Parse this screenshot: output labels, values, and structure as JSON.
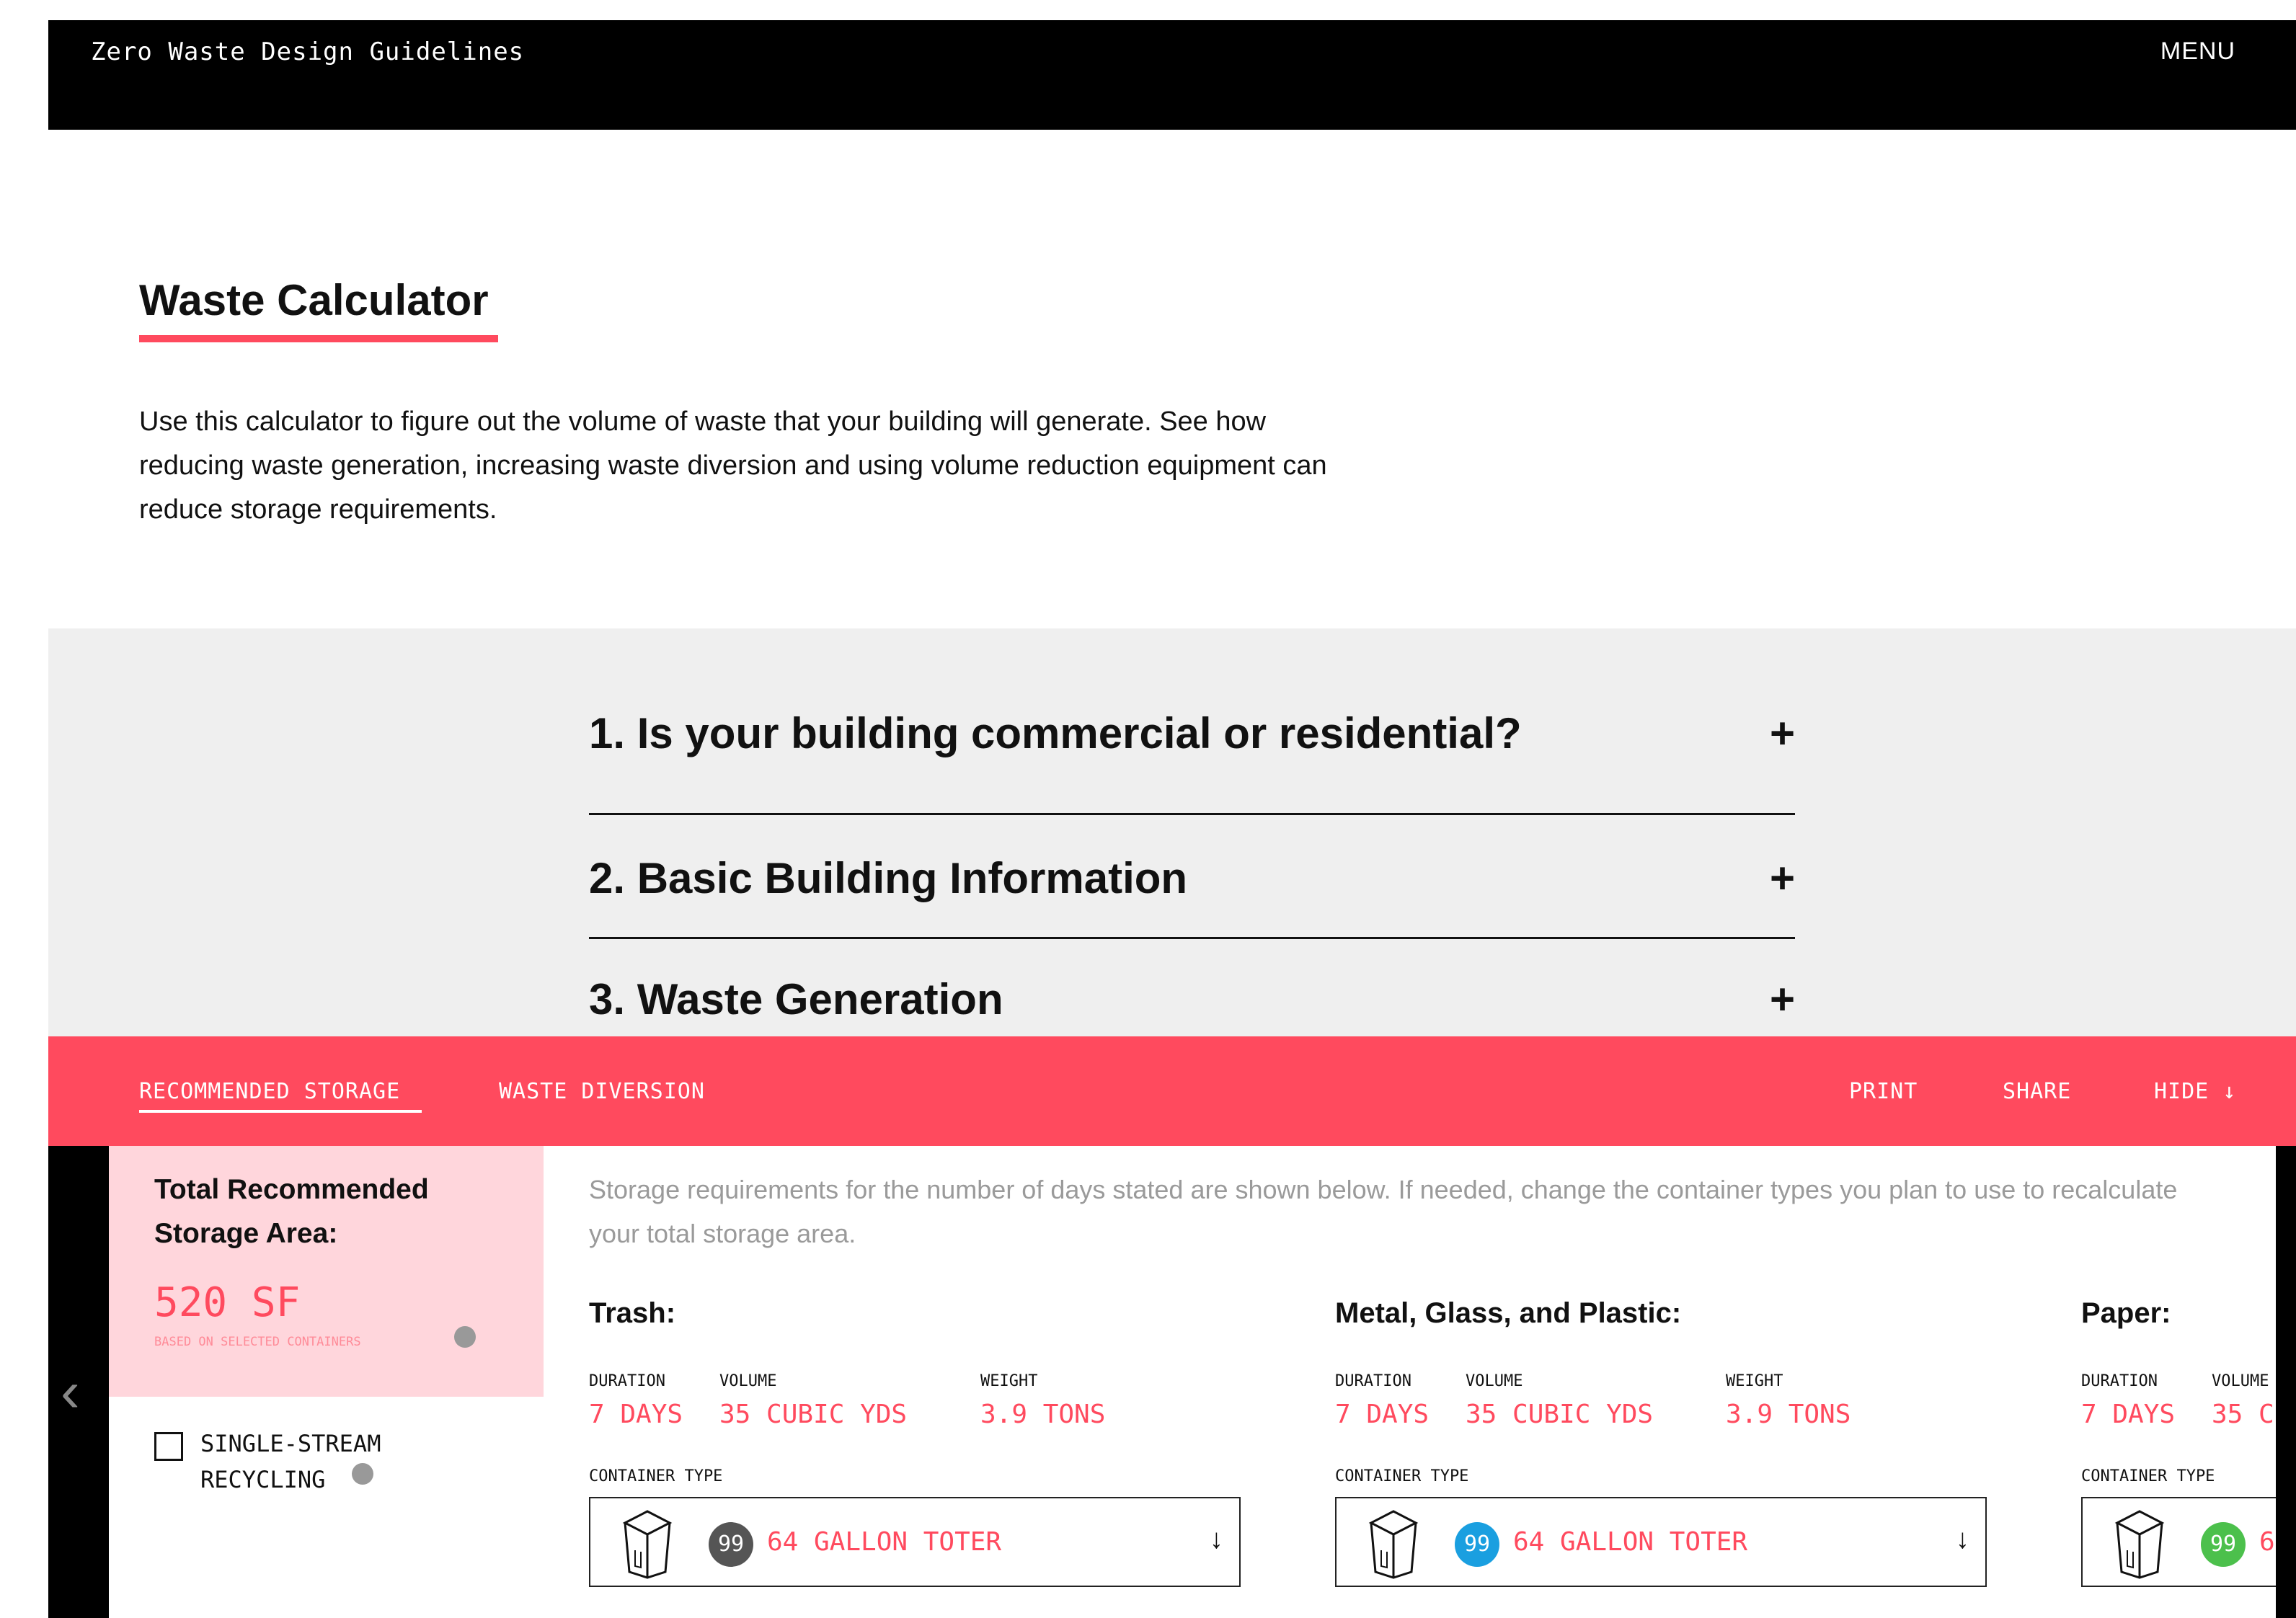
{
  "header": {
    "site_title": "Zero Waste Design Guidelines",
    "menu_label": "MENU"
  },
  "page": {
    "title": "Waste Calculator",
    "intro": "Use this calculator to figure out the volume of waste that your building will generate. See how reducing waste generation, increasing waste diversion and using volume reduction equipment can reduce storage requirements."
  },
  "accordion": [
    {
      "label": "1. Is your building commercial or residential?",
      "icon": "+"
    },
    {
      "label": "2. Basic Building Information",
      "icon": "+"
    },
    {
      "label": "3. Waste Generation",
      "icon": "+"
    }
  ],
  "results_bar": {
    "tabs": [
      "RECOMMENDED STORAGE",
      "WASTE DIVERSION"
    ],
    "actions": [
      "PRINT",
      "SHARE",
      "HIDE ↓"
    ]
  },
  "storage": {
    "label": "Total Recommended Storage Area:",
    "value": "520 SF",
    "note": "BASED ON SELECTED CONTAINERS",
    "checkbox_label": "SINGLE-STREAM RECYCLING",
    "description": "Storage requirements for the number of days stated are shown below. If needed, change the container types you plan to use to recalculate your total storage area."
  },
  "columns": [
    {
      "title": "Trash:",
      "duration_label": "DURATION",
      "duration": "7 DAYS",
      "volume_label": "VOLUME",
      "volume": "35 CUBIC YDS",
      "weight_label": "WEIGHT",
      "weight": "3.9 TONS",
      "container_label": "CONTAINER TYPE",
      "badge": "99",
      "badge_color": "#555555",
      "container": "64 GALLON TOTER",
      "arrow": "↓"
    },
    {
      "title": "Metal, Glass, and Plastic:",
      "duration_label": "DURATION",
      "duration": "7 DAYS",
      "volume_label": "VOLUME",
      "volume": "35 CUBIC YDS",
      "weight_label": "WEIGHT",
      "weight": "3.9 TONS",
      "container_label": "CONTAINER TYPE",
      "badge": "99",
      "badge_color": "#1a9fe0",
      "container": "64 GALLON TOTER",
      "arrow": "↓"
    },
    {
      "title": "Paper:",
      "duration_label": "DURATION",
      "duration": "7 DAYS",
      "volume_label": "VOLUME",
      "volume": "35 C",
      "container_label": "CONTAINER TYPE",
      "badge": "99",
      "badge_color": "#4cc04c",
      "container": "6"
    }
  ],
  "colors": {
    "accent": "#ff4a5e",
    "storage_bg": "#ffd6dc",
    "accordion_bg": "#efefef"
  }
}
